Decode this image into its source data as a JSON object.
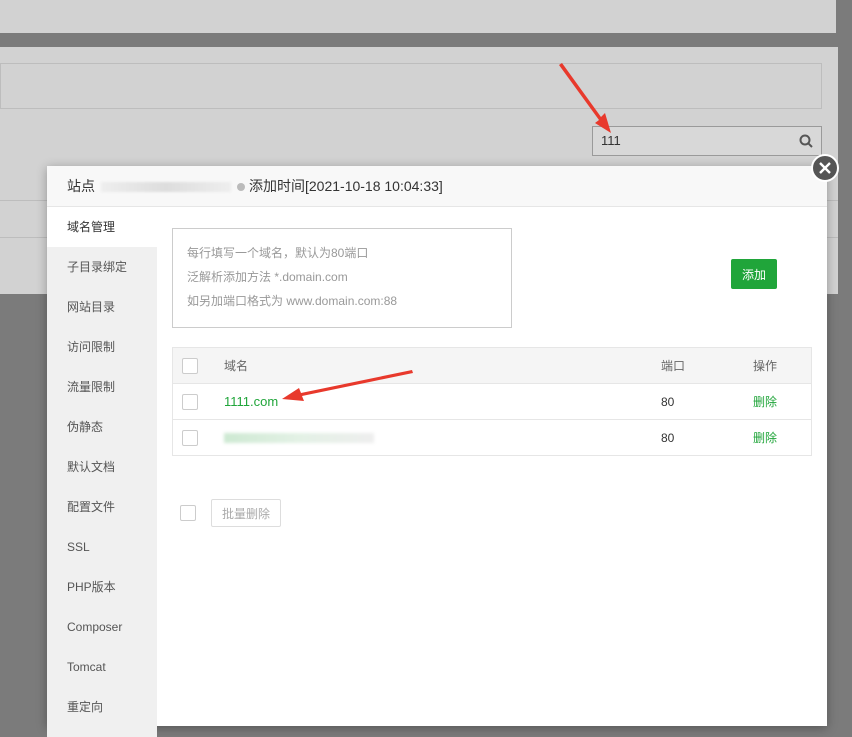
{
  "background": {
    "search": {
      "value": "111"
    }
  },
  "dialog": {
    "title_prefix": "站点",
    "title_added": "添加时间[2021-10-18 10:04:33]",
    "close_label": "×"
  },
  "sidebar": {
    "items": [
      {
        "label": "域名管理",
        "active": true
      },
      {
        "label": "子目录绑定"
      },
      {
        "label": "网站目录"
      },
      {
        "label": "访问限制"
      },
      {
        "label": "流量限制"
      },
      {
        "label": "伪静态"
      },
      {
        "label": "默认文档"
      },
      {
        "label": "配置文件"
      },
      {
        "label": "SSL"
      },
      {
        "label": "PHP版本"
      },
      {
        "label": "Composer"
      },
      {
        "label": "Tomcat"
      },
      {
        "label": "重定向"
      }
    ]
  },
  "domain_input": {
    "hint_1": "每行填写一个域名，默认为80端口",
    "hint_2": "泛解析添加方法 *.domain.com",
    "hint_3": "如另加端口格式为 www.domain.com:88"
  },
  "add_button": "添加",
  "table": {
    "headers": {
      "domain": "域名",
      "port": "端口",
      "action": "操作"
    },
    "rows": [
      {
        "domain": "1111.com",
        "port": "80",
        "action": "删除"
      },
      {
        "domain": "",
        "port": "80",
        "action": "删除"
      }
    ]
  },
  "batch_delete": "批量删除",
  "colors": {
    "accent": "#20a53a",
    "arrow": "#e8392c"
  }
}
